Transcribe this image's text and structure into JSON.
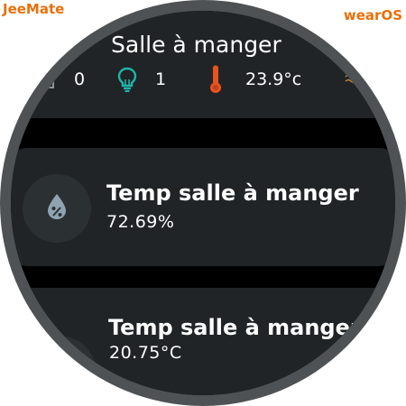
{
  "branding": {
    "left": "JeeMate",
    "right": "wearOS",
    "color": "#e8700a"
  },
  "room": {
    "title": "Salle à manger",
    "stats": {
      "door": {
        "icon": "window-icon",
        "value": "0"
      },
      "light": {
        "icon": "lightbulb-icon",
        "value": "1"
      },
      "temperature": {
        "icon": "thermometer-icon",
        "value": "23.9°c"
      },
      "extra": {
        "icon": "heating-icon"
      }
    }
  },
  "sensors": [
    {
      "icon": "humidity-icon",
      "name": "Temp salle à manger",
      "value": "72.69%"
    },
    {
      "icon": "temperature-sensor-icon",
      "name": "Temp salle à manger",
      "value": "20.75°C"
    }
  ],
  "colors": {
    "card": "#202427",
    "icon_circle": "#2b3033",
    "light_icon": "#1fb5a8",
    "temp_icon": "#e8531f",
    "extra_icon": "#c9872a",
    "sensor_icon": "#8fa3b0"
  }
}
